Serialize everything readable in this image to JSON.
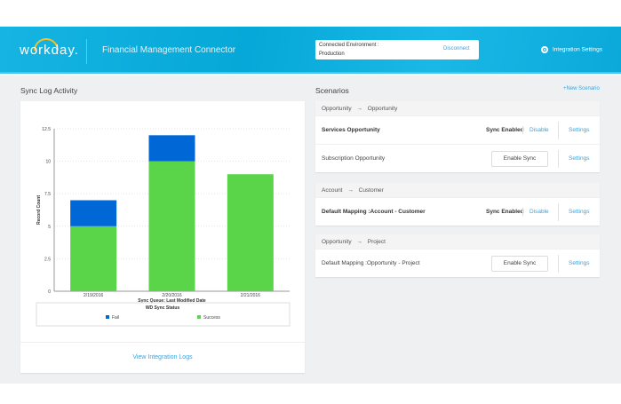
{
  "header": {
    "logo": "workday.",
    "title": "Financial Management Connector",
    "env_label": "Connected Environment :",
    "env_value": "Production",
    "disconnect": "Disconnect",
    "integration_settings": "Integration Settings"
  },
  "sync_log": {
    "title": "Sync Log Activity",
    "view_logs": "View Integration Logs"
  },
  "chart_data": {
    "type": "bar",
    "stacked": true,
    "categories": [
      "2/19/2016",
      "2/20/2016",
      "2/21/2016"
    ],
    "series": [
      {
        "name": "Success",
        "color": "#5ad448",
        "values": [
          5,
          10,
          9
        ]
      },
      {
        "name": "Fail",
        "color": "#0068d6",
        "values": [
          2,
          2,
          0
        ]
      }
    ],
    "xlabel": "Sync Queue: Last Modified Date",
    "ylabel": "Record Count",
    "ylim": [
      0,
      12.5
    ],
    "yticks": [
      "0",
      "2.5",
      "5",
      "7.5",
      "10",
      "12.5"
    ],
    "legend_title": "WD Sync Status",
    "legend_labels": [
      "Fail",
      "Success"
    ],
    "legend": "bottom",
    "grid": true
  },
  "scenarios": {
    "title": "Scenarios",
    "new": "+New Scenario",
    "groups": [
      {
        "from": "Opportunity",
        "to": "Opportunity",
        "rows": [
          {
            "name": "Services Opportunity",
            "enabled": true,
            "status": "Sync Enabled",
            "action": "Disable",
            "settings": "Settings"
          },
          {
            "name": "Subscription Opportunity",
            "enabled": false,
            "action": "Enable Sync",
            "settings": "Settings"
          }
        ]
      },
      {
        "from": "Account",
        "to": "Customer",
        "rows": [
          {
            "name": "Default Mapping :Account - Customer",
            "enabled": true,
            "status": "Sync Enabled",
            "action": "Disable",
            "settings": "Settings"
          }
        ]
      },
      {
        "from": "Opportunity",
        "to": "Project",
        "rows": [
          {
            "name": "Default Mapping :Opportunity - Project",
            "enabled": false,
            "action": "Enable Sync",
            "settings": "Settings"
          }
        ]
      }
    ]
  },
  "arrow": "→"
}
